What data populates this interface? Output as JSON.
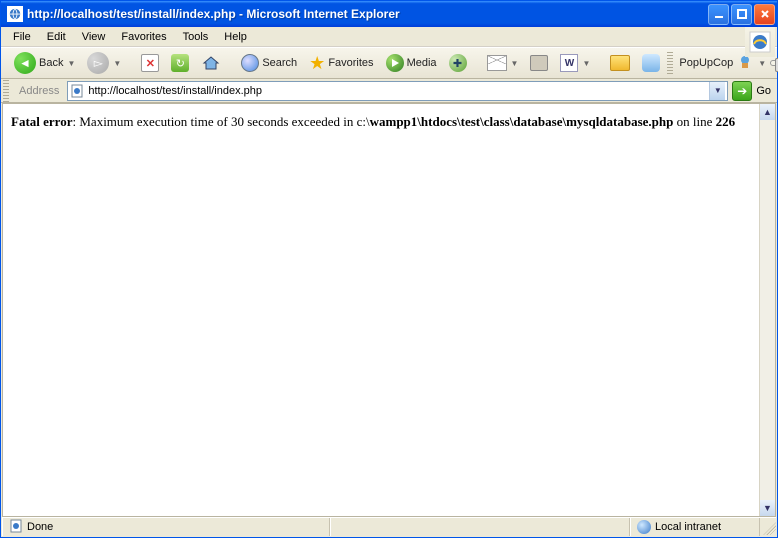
{
  "title": "http://localhost/test/install/index.php - Microsoft Internet Explorer",
  "menu": [
    "File",
    "Edit",
    "View",
    "Favorites",
    "Tools",
    "Help"
  ],
  "toolbar": {
    "back": "Back",
    "search": "Search",
    "favorites": "Favorites",
    "media": "Media",
    "popupcop": "PopUpCop"
  },
  "address": {
    "label": "Address",
    "url": "http://localhost/test/install/index.php",
    "go": "Go"
  },
  "page": {
    "err_label": "Fatal error",
    "err_sep": ": ",
    "err_msg1": "Maximum execution time of 30 seconds exceeded in c:\\",
    "err_path": "wampp1\\htdocs\\test\\class\\database\\mysqldatabase.php",
    "err_msg2": " on line ",
    "err_line": "226"
  },
  "status": {
    "done": "Done",
    "zone": "Local intranet"
  }
}
